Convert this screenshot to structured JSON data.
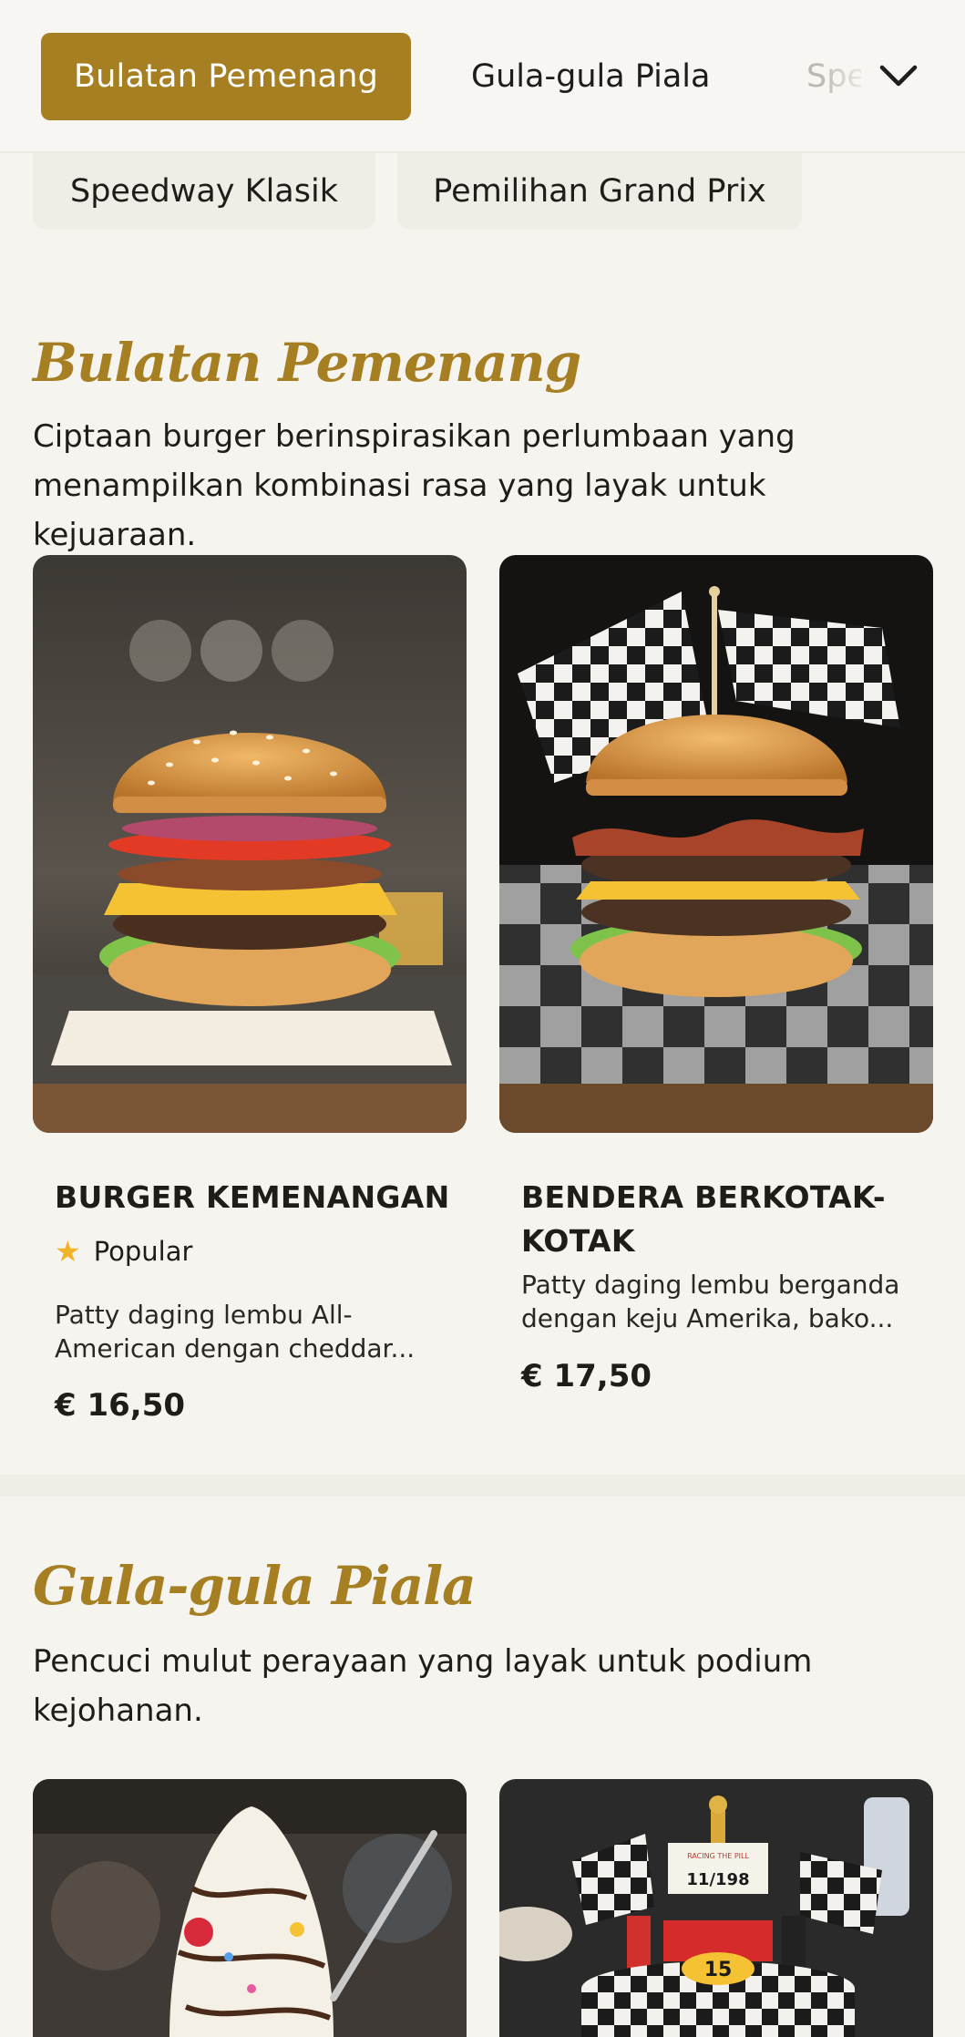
{
  "tabs": {
    "active": "Bulatan Pemenang",
    "second": "Gula-gula Piala",
    "third_partial": "Speedway Klasik",
    "more_icon": "chevron-down-icon"
  },
  "chips": [
    "Speedway Klasik",
    "Pemilihan Grand Prix"
  ],
  "sections": [
    {
      "title": "Bulatan Pemenang",
      "description": "Ciptaan burger berinspirasikan perlumbaan yang menampilkan kombinasi rasa yang layak untuk kejuaraan.",
      "items": [
        {
          "name": "BURGER KEMENANGAN",
          "badge": "Popular",
          "badge_icon": "star-icon",
          "description": "Patty daging lembu All-American dengan cheddar...",
          "price": "€ 16,50"
        },
        {
          "name": "BENDERA BERKOTAK-KOTAK",
          "description": "Patty daging lembu berganda dengan keju Amerika, bako...",
          "price": "€ 17,50"
        }
      ]
    },
    {
      "title": "Gula-gula Piala",
      "description": "Pencuci mulut perayaan yang layak untuk podium kejohanan.",
      "items": [
        {
          "image_text": [
            "RACING THE PILL",
            "11/198",
            "15"
          ]
        }
      ]
    }
  ],
  "colors": {
    "accent": "#a57f22",
    "background": "#f6f4ef",
    "chip": "#efede5",
    "star": "#f0b429"
  }
}
